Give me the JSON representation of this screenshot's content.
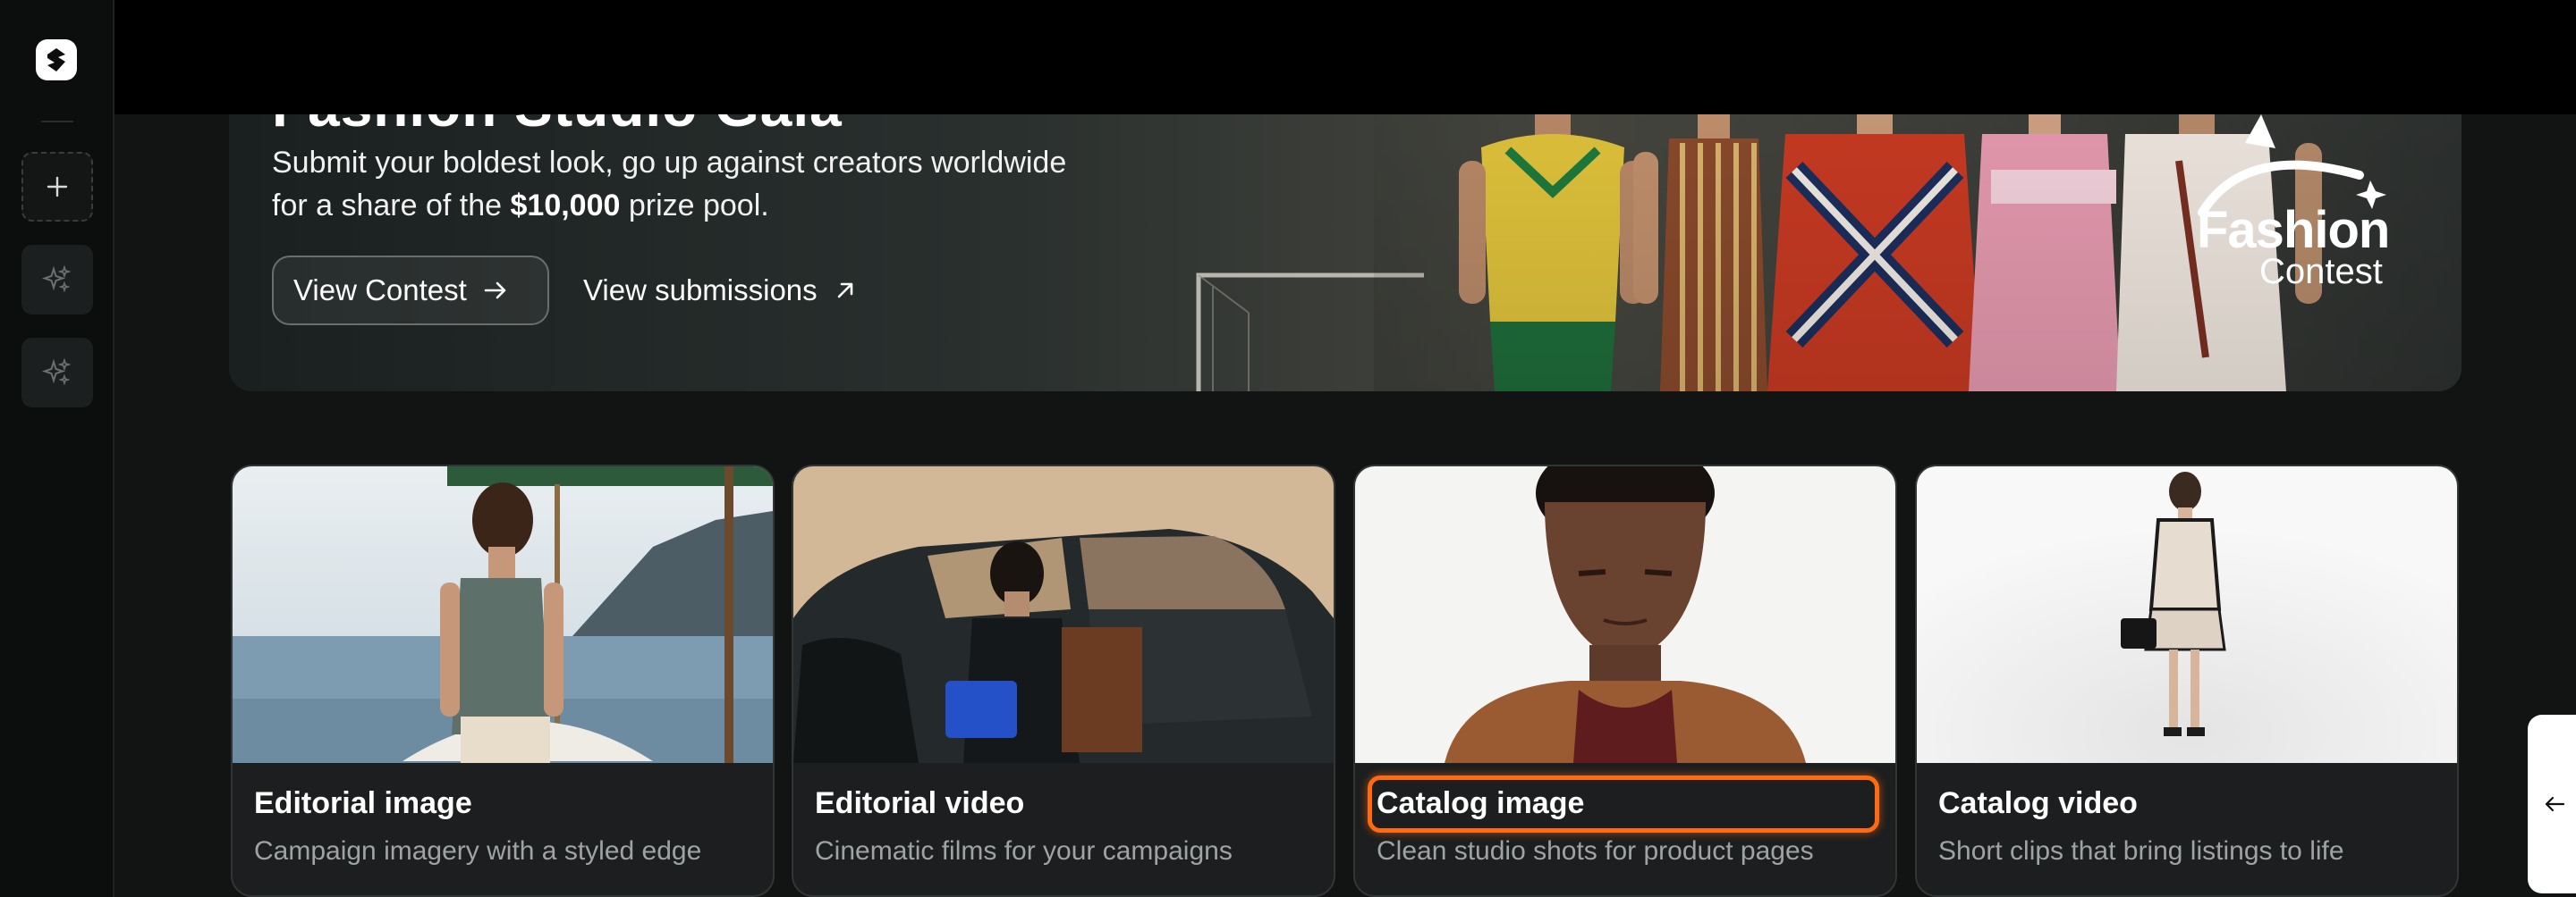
{
  "app": {
    "logo": "brand-logo"
  },
  "sidebar": {
    "items": [
      {
        "name": "new-project",
        "icon": "plus-icon"
      },
      {
        "name": "sparkle-tool-1",
        "icon": "sparkle-icon"
      },
      {
        "name": "sparkle-tool-2",
        "icon": "sparkle-icon"
      }
    ]
  },
  "banner": {
    "title": "Fashion Studio Gala",
    "description_pre": "Submit your boldest look, go up against creators worldwide for a share of the ",
    "prize": "$10,000",
    "description_post": " prize pool.",
    "primary_button": "View Contest",
    "secondary_button": "View submissions",
    "logo_line1": "Fashion",
    "logo_line2": "Contest"
  },
  "cards": [
    {
      "title": "Editorial image",
      "description": "Campaign imagery with a styled edge"
    },
    {
      "title": "Editorial video",
      "description": "Cinematic films for your campaigns"
    },
    {
      "title": "Catalog image",
      "description": "Clean studio shots for product pages",
      "focused": true
    },
    {
      "title": "Catalog video",
      "description": "Short clips that bring listings to life"
    }
  ],
  "colors": {
    "accent_focus": "#ff6a10",
    "background": "#121414",
    "card": "#1c1e1f"
  }
}
